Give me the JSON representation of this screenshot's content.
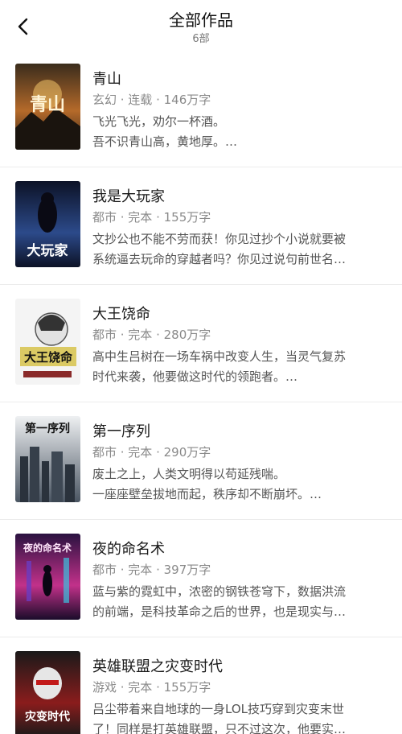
{
  "header": {
    "title": "全部作品",
    "count": "6部"
  },
  "books": [
    {
      "title": "青山",
      "meta": "玄幻 · 连载 · 146万字",
      "desc_lines": [
        "飞光飞光，劝尔一杯酒。",
        "吾不识青山高，黄地厚。…"
      ],
      "cover_text": "青山",
      "cover_colors": [
        "#2a2218",
        "#b56a2a"
      ]
    },
    {
      "title": "我是大玩家",
      "meta": "都市 · 完本 · 155万字",
      "desc_lines": [
        "文抄公也不能不劳而获！你见过抄个小说就要被",
        "系统逼去玩命的穿越者吗？你见过说句前世名…"
      ],
      "cover_text": "大玩家",
      "cover_colors": [
        "#10182e",
        "#2c4a8a"
      ]
    },
    {
      "title": "大王饶命",
      "meta": "都市 · 完本 · 280万字",
      "desc_lines": [
        "高中生吕树在一场车祸中改变人生，当灵气复苏",
        "时代来袭，他要做这时代的领跑者。…"
      ],
      "cover_text": "大王饶命",
      "cover_colors": [
        "#f4f4f4",
        "#d6c24a"
      ]
    },
    {
      "title": "第一序列",
      "meta": "都市 · 完本 · 290万字",
      "desc_lines": [
        "废土之上，人类文明得以苟延残喘。",
        "一座座壁垒拔地而起，秩序却不断崩坏。…"
      ],
      "cover_text": "第一序列",
      "cover_colors": [
        "#d8dde2",
        "#4a5562"
      ]
    },
    {
      "title": "夜的命名术",
      "meta": "都市 · 完本 · 397万字",
      "desc_lines": [
        "蓝与紫的霓虹中，浓密的钢铁苍穹下，数据洪流",
        "的前端，是科技革命之后的世界，也是现实与…"
      ],
      "cover_text": "夜的命名术",
      "cover_colors": [
        "#2a1240",
        "#c2318a"
      ]
    },
    {
      "title": "英雄联盟之灾变时代",
      "meta": "游戏 · 完本 · 155万字",
      "desc_lines": [
        "吕尘带着来自地球的一身LOL技巧穿到灾变末世",
        "了！同样是打英雄联盟，只不过这次，他要实…"
      ],
      "cover_text": "灾变时代",
      "cover_colors": [
        "#1a1a1a",
        "#8a1c1c"
      ]
    }
  ]
}
